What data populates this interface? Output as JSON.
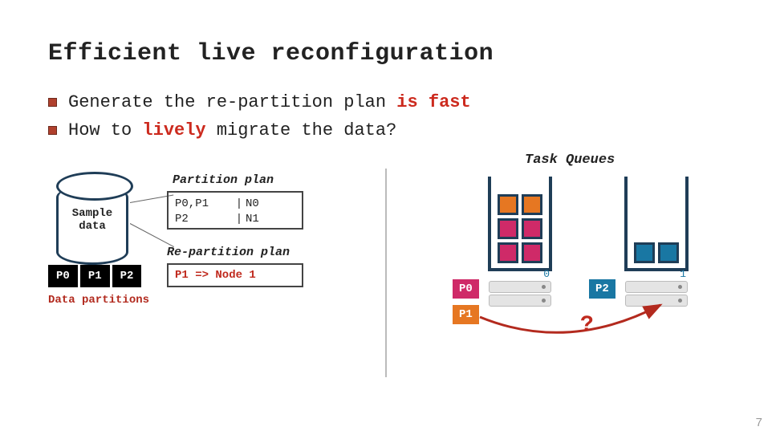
{
  "slide_number": "7",
  "title": "Efficient live reconfiguration",
  "bullets": [
    {
      "pre": "Generate the re-partition plan ",
      "em": "is fast",
      "post": ""
    },
    {
      "pre": "How to ",
      "em": "lively",
      "post": " migrate the data?"
    }
  ],
  "left": {
    "cylinder_label_l1": "Sample",
    "cylinder_label_l2": "data",
    "partition_plan_label": "Partition plan",
    "pp_rows": [
      {
        "c1": "P0,P1",
        "sep": "|",
        "c2": "N0"
      },
      {
        "c1": "P2",
        "sep": "|",
        "c2": "N1"
      }
    ],
    "repartition_plan_label": "Re-partition plan",
    "rp_text": "P1 => Node 1",
    "chips": [
      "P0",
      "P1",
      "P2"
    ],
    "partitions_caption": "Data partitions"
  },
  "right": {
    "tq_title": "Task Queues",
    "server0_idx": "0",
    "server1_idx": "1",
    "tag_p0": "P0",
    "tag_p1": "P1",
    "tag_p2": "P2",
    "qmark": "?"
  }
}
